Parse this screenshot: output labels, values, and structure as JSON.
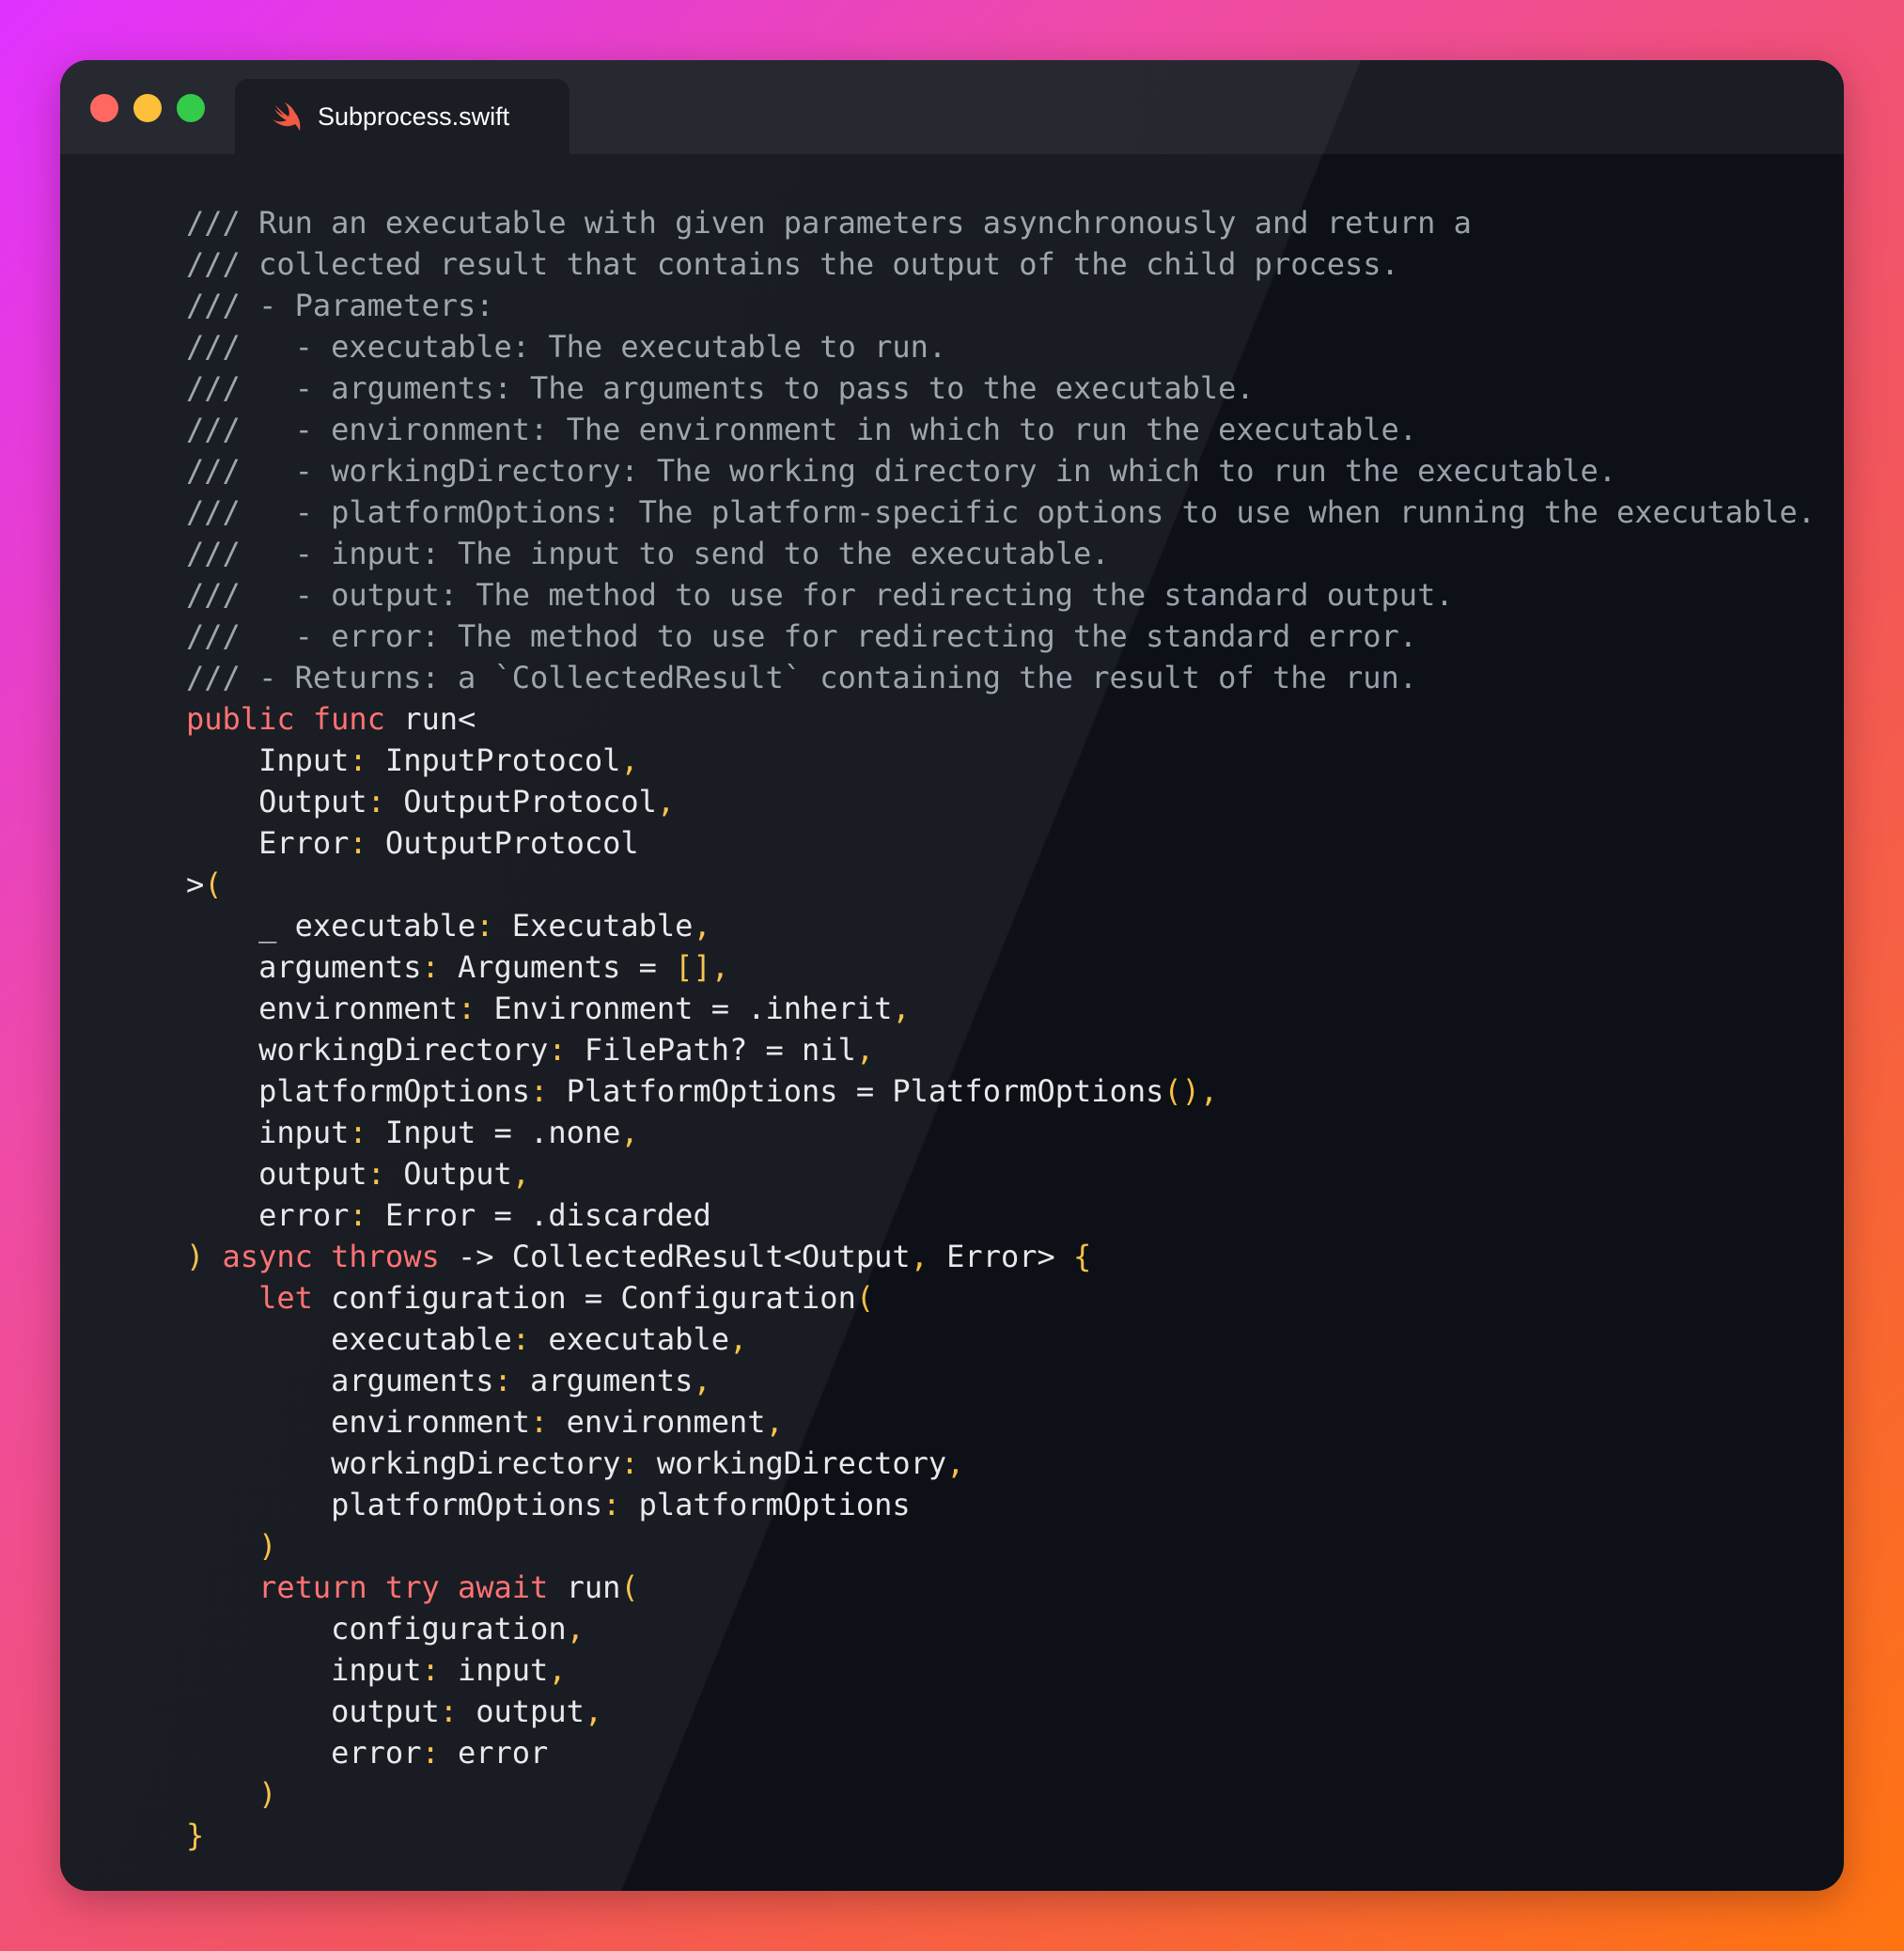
{
  "window": {
    "tab": {
      "filename": "Subprocess.swift",
      "icon": "swift-icon"
    }
  },
  "colors": {
    "comment": "#9aa0aa",
    "keyword": "#ff6b6b",
    "punctuation": "#fac042",
    "text": "#e8e8ea",
    "line_number": "#8b8f99",
    "background": "#0d1017"
  },
  "code": {
    "lines": [
      [
        [
          "cm",
          "/// Run an executable with given parameters asynchronously and return a"
        ]
      ],
      [
        [
          "cm",
          "/// collected result that contains the output of the child process."
        ]
      ],
      [
        [
          "cm",
          "/// - Parameters:"
        ]
      ],
      [
        [
          "cm",
          "///   - executable: The executable to run."
        ]
      ],
      [
        [
          "cm",
          "///   - arguments: The arguments to pass to the executable."
        ]
      ],
      [
        [
          "cm",
          "///   - environment: The environment in which to run the executable."
        ]
      ],
      [
        [
          "cm",
          "///   - workingDirectory: The working directory in which to run the executable."
        ]
      ],
      [
        [
          "cm",
          "///   - platformOptions: The platform-specific options to use when running the executable."
        ]
      ],
      [
        [
          "cm",
          "///   - input: The input to send to the executable."
        ]
      ],
      [
        [
          "cm",
          "///   - output: The method to use for redirecting the standard output."
        ]
      ],
      [
        [
          "cm",
          "///   - error: The method to use for redirecting the standard error."
        ]
      ],
      [
        [
          "cm",
          "/// - Returns: a `CollectedResult` containing the result of the run."
        ]
      ],
      [
        [
          "kw",
          "public"
        ],
        [
          "tx",
          " "
        ],
        [
          "kw",
          "func"
        ],
        [
          "tx",
          " run<"
        ]
      ],
      [
        [
          "tx",
          "    Input"
        ],
        [
          "pn",
          ":"
        ],
        [
          "tx",
          " InputProtocol"
        ],
        [
          "pn",
          ","
        ]
      ],
      [
        [
          "tx",
          "    Output"
        ],
        [
          "pn",
          ":"
        ],
        [
          "tx",
          " OutputProtocol"
        ],
        [
          "pn",
          ","
        ]
      ],
      [
        [
          "tx",
          "    Error"
        ],
        [
          "pn",
          ":"
        ],
        [
          "tx",
          " OutputProtocol"
        ]
      ],
      [
        [
          "tx",
          ">"
        ],
        [
          "pn",
          "("
        ]
      ],
      [
        [
          "tx",
          "    _ executable"
        ],
        [
          "pn",
          ":"
        ],
        [
          "tx",
          " Executable"
        ],
        [
          "pn",
          ","
        ]
      ],
      [
        [
          "tx",
          "    arguments"
        ],
        [
          "pn",
          ":"
        ],
        [
          "tx",
          " Arguments = "
        ],
        [
          "pn",
          "[],"
        ]
      ],
      [
        [
          "tx",
          "    environment"
        ],
        [
          "pn",
          ":"
        ],
        [
          "tx",
          " Environment = .inherit"
        ],
        [
          "pn",
          ","
        ]
      ],
      [
        [
          "tx",
          "    workingDirectory"
        ],
        [
          "pn",
          ":"
        ],
        [
          "tx",
          " FilePath? = nil"
        ],
        [
          "pn",
          ","
        ]
      ],
      [
        [
          "tx",
          "    platformOptions"
        ],
        [
          "pn",
          ":"
        ],
        [
          "tx",
          " PlatformOptions = PlatformOptions"
        ],
        [
          "pn",
          "(),"
        ]
      ],
      [
        [
          "tx",
          "    input"
        ],
        [
          "pn",
          ":"
        ],
        [
          "tx",
          " Input = .none"
        ],
        [
          "pn",
          ","
        ]
      ],
      [
        [
          "tx",
          "    output"
        ],
        [
          "pn",
          ":"
        ],
        [
          "tx",
          " Output"
        ],
        [
          "pn",
          ","
        ]
      ],
      [
        [
          "tx",
          "    error"
        ],
        [
          "pn",
          ":"
        ],
        [
          "tx",
          " Error = .discarded"
        ]
      ],
      [
        [
          "pn",
          ")"
        ],
        [
          "tx",
          " "
        ],
        [
          "kw",
          "async"
        ],
        [
          "tx",
          " "
        ],
        [
          "kw",
          "throws"
        ],
        [
          "tx",
          " -> CollectedResult<Output"
        ],
        [
          "pn",
          ","
        ],
        [
          "tx",
          " Error> "
        ],
        [
          "pn",
          "{"
        ]
      ],
      [
        [
          "tx",
          "    "
        ],
        [
          "kw",
          "let"
        ],
        [
          "tx",
          " configuration = Configuration"
        ],
        [
          "pn",
          "("
        ]
      ],
      [
        [
          "tx",
          "        executable"
        ],
        [
          "pn",
          ":"
        ],
        [
          "tx",
          " executable"
        ],
        [
          "pn",
          ","
        ]
      ],
      [
        [
          "tx",
          "        arguments"
        ],
        [
          "pn",
          ":"
        ],
        [
          "tx",
          " arguments"
        ],
        [
          "pn",
          ","
        ]
      ],
      [
        [
          "tx",
          "        environment"
        ],
        [
          "pn",
          ":"
        ],
        [
          "tx",
          " environment"
        ],
        [
          "pn",
          ","
        ]
      ],
      [
        [
          "tx",
          "        workingDirectory"
        ],
        [
          "pn",
          ":"
        ],
        [
          "tx",
          " workingDirectory"
        ],
        [
          "pn",
          ","
        ]
      ],
      [
        [
          "tx",
          "        platformOptions"
        ],
        [
          "pn",
          ":"
        ],
        [
          "tx",
          " platformOptions"
        ]
      ],
      [
        [
          "pn",
          "    )"
        ]
      ],
      [
        [
          "tx",
          "    "
        ],
        [
          "kw",
          "return"
        ],
        [
          "tx",
          " "
        ],
        [
          "kw",
          "try"
        ],
        [
          "tx",
          " "
        ],
        [
          "kw",
          "await"
        ],
        [
          "tx",
          " run"
        ],
        [
          "pn",
          "("
        ]
      ],
      [
        [
          "tx",
          "        configuration"
        ],
        [
          "pn",
          ","
        ]
      ],
      [
        [
          "tx",
          "        input"
        ],
        [
          "pn",
          ":"
        ],
        [
          "tx",
          " input"
        ],
        [
          "pn",
          ","
        ]
      ],
      [
        [
          "tx",
          "        output"
        ],
        [
          "pn",
          ":"
        ],
        [
          "tx",
          " output"
        ],
        [
          "pn",
          ","
        ]
      ],
      [
        [
          "tx",
          "        error"
        ],
        [
          "pn",
          ":"
        ],
        [
          "tx",
          " error"
        ]
      ],
      [
        [
          "pn",
          "    )"
        ]
      ],
      [
        [
          "pn",
          "}"
        ]
      ]
    ]
  }
}
